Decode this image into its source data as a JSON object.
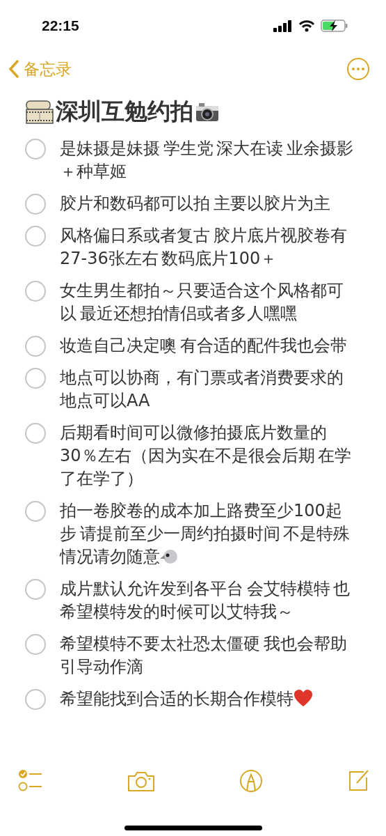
{
  "status_bar": {
    "time": "22:15"
  },
  "nav": {
    "back_label": "备忘录"
  },
  "note": {
    "title": "深圳互勉约拍",
    "items": [
      {
        "text": "是妹摄是妹摄 学生党 深大在读 业余摄影＋种草姬",
        "checked": false
      },
      {
        "text": "胶片和数码都可以拍 主要以胶片为主",
        "checked": false
      },
      {
        "text": "风格偏日系或者复古 胶片底片视胶卷有27-36张左右 数码底片100＋",
        "checked": false
      },
      {
        "text": "女生男生都拍～只要适合这个风格都可以 最近还想拍情侣或者多人嘿嘿",
        "checked": false
      },
      {
        "text": "妆造自己决定噢 有合适的配件我也会带",
        "checked": false
      },
      {
        "text": "地点可以协商，有门票或者消费要求的地点可以AA",
        "checked": false
      },
      {
        "text": "后期看时间可以微修拍摄底片数量的30％左右（因为实在不是很会后期 在学了在学了）",
        "checked": false
      },
      {
        "text": "拍一卷胶卷的成本加上路费至少100起步 请提前至少一周约拍摄时间 不是特殊情况请勿随意",
        "checked": false,
        "kind": "bird"
      },
      {
        "text": "成片默认允许发到各平台 会艾特模特 也希望模特发的时候可以艾特我～",
        "checked": false
      },
      {
        "text": "希望模特不要太社恐太僵硬 我也会帮助引导动作滴",
        "checked": false
      },
      {
        "text": "希望能找到合适的长期合作模特",
        "checked": false,
        "kind": "heart"
      }
    ]
  }
}
